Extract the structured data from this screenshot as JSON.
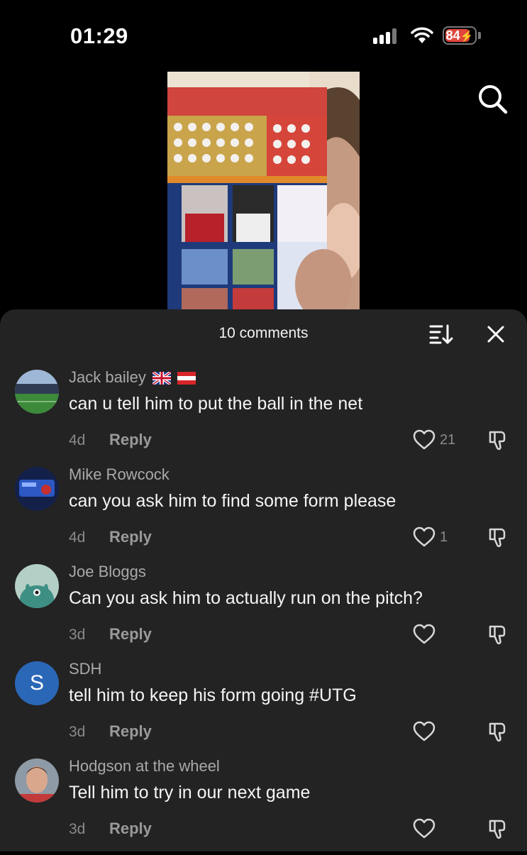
{
  "status": {
    "time": "01:29",
    "battery": "84",
    "battery_level_pct": 84
  },
  "sheet": {
    "comment_count_label": "10 comments"
  },
  "comments": [
    {
      "username": "Jack bailey",
      "flags": [
        "uk-flag-icon",
        "austria-flag-icon"
      ],
      "text": "can u tell him to put the ball in the net",
      "time": "4d",
      "reply_label": "Reply",
      "likes": "21",
      "avatar": "stadium-avatar"
    },
    {
      "username": "Mike Rowcock",
      "text": "can you ask him to find some form please",
      "time": "4d",
      "reply_label": "Reply",
      "likes": "1",
      "avatar": "blue-crest-avatar"
    },
    {
      "username": "Joe Bloggs",
      "text": "Can you ask him to actually run on the pitch?",
      "time": "3d",
      "reply_label": "Reply",
      "likes": "",
      "avatar": "teal-monster-avatar"
    },
    {
      "username": "SDH",
      "avatar_letter": "S",
      "text": "tell him to keep his form going #UTG",
      "time": "3d",
      "reply_label": "Reply",
      "likes": "",
      "avatar": "letter-avatar"
    },
    {
      "username": "Hodgson at the wheel",
      "text": "Tell him to try in our next game",
      "time": "3d",
      "reply_label": "Reply",
      "likes": "",
      "avatar": "player-photo-avatar"
    }
  ],
  "colors": {
    "sheet_bg": "#232323",
    "battery_low": "#e0463c",
    "avatar_letter_bg": "#2b67b7"
  }
}
